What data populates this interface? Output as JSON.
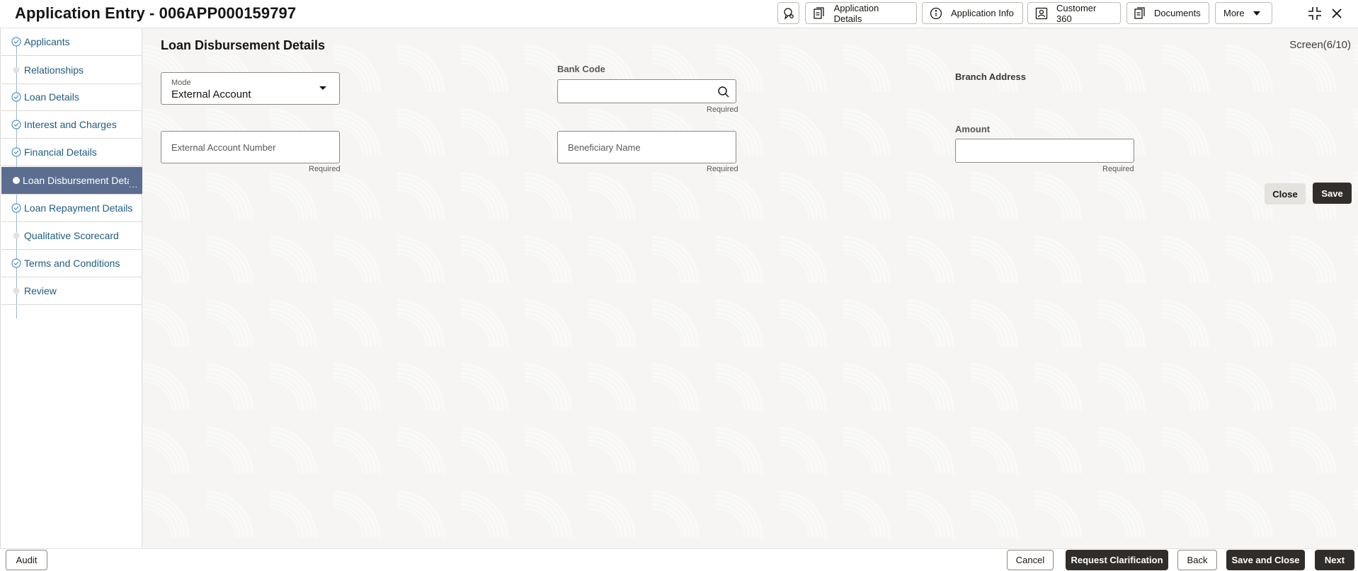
{
  "header": {
    "title": "Application Entry - 006APP000159797",
    "buttons": {
      "application_details": "Application Details",
      "application_info": "Application Info",
      "customer_360": "Customer 360",
      "documents": "Documents",
      "more": "More"
    }
  },
  "sidebar": {
    "items": [
      {
        "label": "Applicants",
        "status": "complete"
      },
      {
        "label": "Relationships",
        "status": "pending"
      },
      {
        "label": "Loan Details",
        "status": "complete"
      },
      {
        "label": "Interest and Charges",
        "status": "complete"
      },
      {
        "label": "Financial Details",
        "status": "complete"
      },
      {
        "label": "Loan Disbursement Details",
        "status": "active"
      },
      {
        "label": "Loan Repayment Details",
        "status": "complete"
      },
      {
        "label": "Qualitative Scorecard",
        "status": "pending"
      },
      {
        "label": "Terms and Conditions",
        "status": "complete"
      },
      {
        "label": "Review",
        "status": "pending"
      }
    ],
    "overflow_indicator": "..."
  },
  "main": {
    "section_title": "Loan Disbursement Details",
    "screen_counter": "Screen(6/10)",
    "fields": {
      "mode": {
        "label": "Mode",
        "value": "External Account"
      },
      "bank_code": {
        "label": "Bank Code",
        "value": "",
        "hint": "Required"
      },
      "branch_address": {
        "label": "Branch Address"
      },
      "external_account_number": {
        "placeholder": "External Account Number",
        "hint": "Required"
      },
      "beneficiary_name": {
        "placeholder": "Beneficiary Name",
        "hint": "Required"
      },
      "amount": {
        "label": "Amount",
        "value": "",
        "hint": "Required"
      }
    },
    "buttons": {
      "close": "Close",
      "save": "Save"
    }
  },
  "footer": {
    "audit": "Audit",
    "cancel": "Cancel",
    "request_clarification": "Request Clarification",
    "back": "Back",
    "save_and_close": "Save and Close",
    "next": "Next"
  },
  "colors": {
    "sidebar_active_bg": "#5c6e8f",
    "sidebar_link": "#1f5c80",
    "primary_button": "#312d2a"
  }
}
